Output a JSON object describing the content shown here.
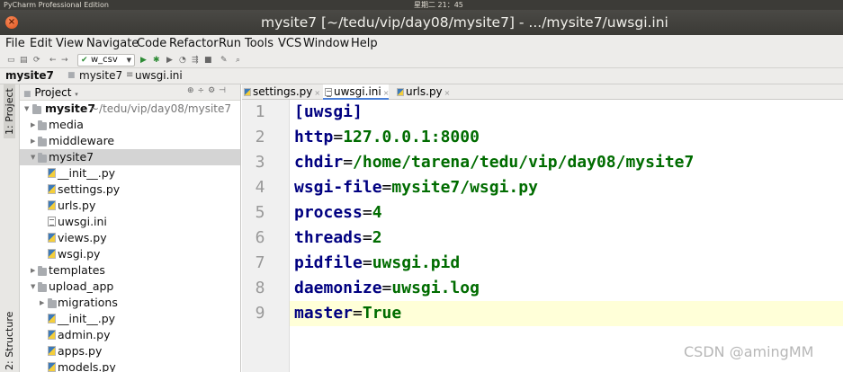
{
  "os_bar": {
    "app_name": "PyCharm Professional Edition",
    "clock": "星期二 21：45"
  },
  "window": {
    "close_glyph": "×",
    "title": "mysite7 [~/tedu/vip/day08/mysite7] - .../mysite7/uwsgi.ini"
  },
  "menu": [
    "File",
    "Edit",
    "View",
    "Navigate",
    "Code",
    "Refactor",
    "Run",
    "Tools",
    "VCS",
    "Window",
    "Help"
  ],
  "toolbar": {
    "run_config": "w_csv"
  },
  "breadcrumb": [
    "mysite7",
    "mysite7",
    "uwsgi.ini"
  ],
  "side_tabs": {
    "project": "1: Project",
    "structure": "2: Structure"
  },
  "project_panel": {
    "title": "Project",
    "root": {
      "name": "mysite7",
      "path": "~/tedu/vip/day08/mysite7"
    },
    "items": [
      "media",
      "middleware",
      "mysite7",
      "__init__.py",
      "settings.py",
      "urls.py",
      "uwsgi.ini",
      "views.py",
      "wsgi.py",
      "templates",
      "upload_app",
      "migrations",
      "__init__.py",
      "admin.py",
      "apps.py",
      "models.py"
    ]
  },
  "editor_tabs": [
    "settings.py",
    "uwsgi.ini",
    "urls.py"
  ],
  "code": {
    "line_numbers": [
      "1",
      "2",
      "3",
      "4",
      "5",
      "6",
      "7",
      "8",
      "9"
    ],
    "section": "[uwsgi]",
    "lines": [
      {
        "key": "http",
        "value": "127.0.0.1:8000"
      },
      {
        "key": "chdir",
        "value": "/home/tarena/tedu/vip/day08/mysite7"
      },
      {
        "key": "wsgi-file",
        "value": "mysite7/wsgi.py"
      },
      {
        "key": "process",
        "value": "4"
      },
      {
        "key": "threads",
        "value": "2"
      },
      {
        "key": "pidfile",
        "value": "uwsgi.pid"
      },
      {
        "key": "daemonize",
        "value": "uwsgi.log"
      },
      {
        "key": "master",
        "value": "True"
      }
    ]
  },
  "watermark": "CSDN @amingMM"
}
